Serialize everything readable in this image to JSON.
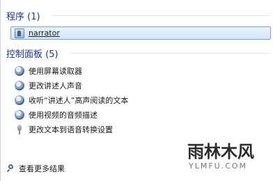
{
  "programs": {
    "title": "程序 (1)",
    "items": [
      {
        "label": "narrator",
        "icon": "program-icon"
      }
    ]
  },
  "control_panel": {
    "title": "控制面板 (5)",
    "items": [
      {
        "label": "使用屏幕读取器",
        "icon": "ease-of-access-icon"
      },
      {
        "label": "更改讲述人声音",
        "icon": "ease-of-access-icon"
      },
      {
        "label": "收听“讲述人”高声阅读的文本",
        "icon": "ease-of-access-icon"
      },
      {
        "label": "使用视频的音频描述",
        "icon": "ease-of-access-icon"
      },
      {
        "label": "更改文本到语音转换设置",
        "icon": "microphone-icon"
      }
    ]
  },
  "footer": {
    "search_more": "查看更多结果"
  },
  "watermark": {
    "main": "雨林木风",
    "sub": "YLMFU.COM"
  }
}
